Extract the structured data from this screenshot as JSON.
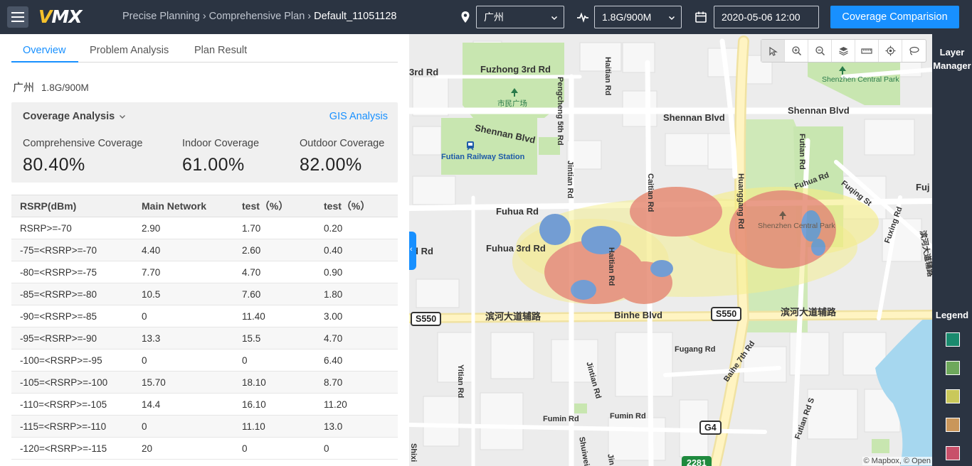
{
  "app": {
    "logo_text_a": "V",
    "logo_text_b": "MX",
    "breadcrumb": [
      "Precise Planning",
      "Comprehensive Plan",
      "Default_11051128"
    ],
    "city_select": "广州",
    "band_select": "1.8G/900M",
    "datetime": "2020-05-06 12:00",
    "compare_button": "Coverage Comparision",
    "icons": [
      "menu-icon",
      "location-pin-icon",
      "signal-wave-icon",
      "calendar-icon",
      "chevron-down-icon"
    ]
  },
  "tabs": [
    "Overview",
    "Problem Analysis",
    "Plan Result"
  ],
  "region": {
    "city": "广州",
    "band": "1.8G/900M"
  },
  "coverage": {
    "title": "Coverage Analysis",
    "gis_link": "GIS Analysis",
    "metrics": [
      {
        "label": "Comprehensive Coverage",
        "value": "80.40%"
      },
      {
        "label": "Indoor Coverage",
        "value": "61.00%"
      },
      {
        "label": "Outdoor Coverage",
        "value": "82.00%"
      }
    ]
  },
  "table": {
    "headers": [
      "RSRP(dBm)",
      "Main Network",
      "test（%）",
      "test（%）"
    ],
    "rows": [
      [
        "RSRP>=-70",
        "2.90",
        "1.70",
        "0.20"
      ],
      [
        "-75=<RSRP>=-70",
        "4.40",
        "2.60",
        "0.40"
      ],
      [
        "-80=<RSRP>=-75",
        "7.70",
        "4.70",
        "0.90"
      ],
      [
        "-85=<RSRP>=-80",
        "10.5",
        "7.60",
        "1.80"
      ],
      [
        "-90=<RSRP>=-85",
        "0",
        "11.40",
        "3.00"
      ],
      [
        "-95=<RSRP>=-90",
        "13.3",
        "15.5",
        "4.70"
      ],
      [
        "-100=<RSRP>=-95",
        "0",
        "0",
        "6.40"
      ],
      [
        "-105=<RSRP>=-100",
        "15.70",
        "18.10",
        "8.70"
      ],
      [
        "-110=<RSRP>=-105",
        "14.4",
        "16.10",
        "11.20"
      ],
      [
        "-115=<RSRP>=-110",
        "0",
        "11.10",
        "13.0"
      ],
      [
        "-120=<RSRP>=-115",
        "20",
        "0",
        "0"
      ]
    ]
  },
  "map": {
    "labels": {
      "fuzhong": "Fuzhong 3rd Rd",
      "rd3": "3rd Rd",
      "shiminguangchang": "市民广场",
      "pengcheng": "Pengcheng 5th Rd",
      "haitian_top": "Haitian Rd",
      "shennan_left": "Shennan Blvd",
      "shennan_mid": "Shennan Blvd",
      "shennan_right": "Shennan Blvd",
      "shenzhen_cp": "Shenzhen Central Park",
      "futian_station": "Futian Railway Station",
      "jintian_top": "Jintian Rd",
      "caitian": "Caitian Rd",
      "huanggang": "Huanggang Rd",
      "futian_rd": "Futian Rd",
      "fuqing": "Fuqing St",
      "fuhua_right": "Fuhua Rd",
      "fuj": "Fuj",
      "fuhua_left": "Fuhua Rd",
      "rd_left": "rd Rd",
      "fuhua3": "Fuhua 3rd Rd",
      "haitian_mid": "Haitian Rd",
      "binhe": "Binhe Blvd",
      "binhe_cn_left": "滨河大道辅路",
      "binhe_cn_right": "滨河大道辅路",
      "binhe_cn_vertical": "滨河大道辅路",
      "fuxing": "Fuxing Rd",
      "fugang": "Fugang Rd",
      "baihe": "Baihe 7th Rd",
      "yitian": "Yitian Rd",
      "jintian_bottom": "Jintian Rd",
      "fumin_left": "Fumin Rd",
      "fumin_right": "Fumin Rd",
      "futian_s": "Futian Rd S",
      "shixi": "Shixi",
      "shuiwei": "Shuiwei",
      "jin": "Jin",
      "cp_center": "Shenzhen Central Park"
    },
    "shields": [
      "S550",
      "S550",
      "G4",
      "2281"
    ],
    "attribution": "© Mapbox, © Open",
    "tools": [
      "pointer-icon",
      "zoom-in-icon",
      "zoom-out-icon",
      "layers-icon",
      "ruler-icon",
      "locate-icon",
      "lasso-icon"
    ]
  },
  "rightbar": {
    "layer_manager": "Layer Manager",
    "legend": "Legend",
    "legend_colors": [
      "#1a8a6e",
      "#6ea85c",
      "#c9c85a",
      "#c9965a",
      "#c8506a"
    ]
  }
}
